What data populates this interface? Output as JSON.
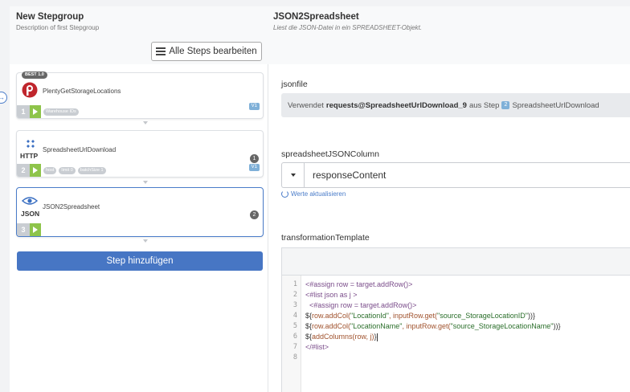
{
  "left": {
    "group_title": "New Stepgroup",
    "group_desc": "Description of first Stepgroup",
    "edit_all_label": "Alle Steps bearbeiten",
    "add_step_label": "Step hinzufügen",
    "steps": [
      {
        "name": "PlentyGetStorageLocations",
        "number": "1",
        "best_badge": "BEST 1.0",
        "icon": "plenty-logo-icon",
        "tags": [
          "Warehouse IDs"
        ],
        "version": "V1",
        "count": ""
      },
      {
        "name": "SpreadsheetUrlDownload",
        "number": "2",
        "icon": "http-icon",
        "icon_label": "HTTP",
        "tags": [
          "host",
          "limit 0",
          "batchSize 1"
        ],
        "version": "V1",
        "count": "1"
      },
      {
        "name": "JSON2Spreadsheet",
        "number": "3",
        "icon": "eye-icon",
        "icon_label": "JSON",
        "tags": [],
        "version": "",
        "count": "2"
      }
    ]
  },
  "right": {
    "title": "JSON2Spreadsheet",
    "desc": "Liest die JSON-Datei in ein SPREADSHEET-Objekt.",
    "jsonfile_label": "jsonfile",
    "jsonfile_prefix": "Verwendet",
    "jsonfile_ref": "requests@SpreadsheetUrlDownload_9",
    "jsonfile_mid": "aus Step",
    "jsonfile_step_num": "2",
    "jsonfile_step_name": "SpreadsheetUrlDownload",
    "column_label": "spreadsheetJSONColumn",
    "column_value": "responseContent",
    "refresh_label": "Werte aktualisieren",
    "template_label": "transformationTemplate",
    "line_numbers": [
      "1",
      "2",
      "3",
      "4",
      "5",
      "6",
      "7",
      "8"
    ],
    "code": {
      "l1_a": "<#assign ",
      "l1_b": "row = target.addRow()",
      "l1_c": ">",
      "l2_a": "<#list ",
      "l2_b": "json as j",
      "l2_c": " >",
      "l3_a": "  <#assign ",
      "l3_b": "row = target.addRow()",
      "l3_c": ">",
      "l4_a": "${",
      "l4_b": "row.addCol(",
      "l4_c": "\"LocationId\"",
      "l4_d": ", inputRow.get(",
      "l4_e": "\"source_StorageLocationID\"",
      "l4_f": "))}",
      "l5_a": "${",
      "l5_b": "row.addCol(",
      "l5_c": "\"LocationName\"",
      "l5_d": ", inputRow.get(",
      "l5_e": "\"source_StorageLocationName\"",
      "l5_f": "))}",
      "l6_a": "${",
      "l6_b": "addColumns(row, j)",
      "l6_c": "}",
      "l7_a": "</#list>"
    }
  },
  "colors": {
    "accent": "#4776c4",
    "play": "#8ec44a",
    "version_badge": "#7fb0d8"
  }
}
